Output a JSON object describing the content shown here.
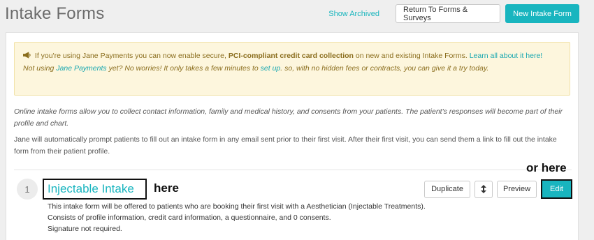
{
  "page": {
    "title": "Intake Forms"
  },
  "header": {
    "show_archived": "Show Archived",
    "return_label": "Return To Forms & Surveys",
    "new_label": "New Intake Form"
  },
  "alert": {
    "line1_prefix": "If you're using Jane Payments you can now enable secure, ",
    "line1_bold": "PCI-compliant credit card collection",
    "line1_suffix": " on new and existing Intake Forms. ",
    "line1_link": "Learn all about it here!",
    "line2_prefix": "Not using ",
    "line2_link1": "Jane Payments",
    "line2_mid": " yet? No worries! It only takes a few minutes to ",
    "line2_link2": "set up",
    "line2_suffix": ". so, with no hidden fees or contracts, you can give it a try today.",
    "icon": "megaphone-icon",
    "color": "#fdf6dd"
  },
  "intro": {
    "p1": "Online intake forms allow you to collect contact information, family and medical history, and consents from your patients. The patient's responses will become part of their profile and chart.",
    "p2": "Jane will automatically prompt patients to fill out an intake form in any email sent prior to their first visit. After their first visit, you can send them a link to fill out the intake form from their patient profile."
  },
  "forms": [
    {
      "number": "1",
      "title": "Injectable Intake",
      "desc_line1": "This intake form will be offered to patients who are booking their first visit with a Aesthetician (Injectable Treatments).",
      "desc_line2": "Consists of profile information, credit card information, a questionnaire, and 0 consents.",
      "desc_line3": "Signature not required.",
      "actions": {
        "duplicate": "Duplicate",
        "sort_icon": "sort-icon",
        "preview": "Preview",
        "edit": "Edit"
      }
    }
  ],
  "annotations": {
    "here": "here",
    "or_here": "or here"
  },
  "colors": {
    "accent": "#19b5bf",
    "alert_text": "#8a6d1d"
  }
}
